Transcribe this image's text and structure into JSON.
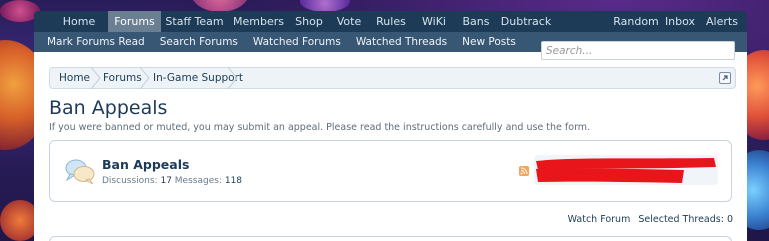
{
  "nav": {
    "tabs": [
      {
        "label": "Home",
        "active": false
      },
      {
        "label": "Forums",
        "active": true
      },
      {
        "label": "Staff Team",
        "active": false
      },
      {
        "label": "Members",
        "active": false
      },
      {
        "label": "Shop",
        "active": false
      },
      {
        "label": "Vote",
        "active": false
      },
      {
        "label": "Rules",
        "active": false
      },
      {
        "label": "WiKi",
        "active": false
      },
      {
        "label": "Bans",
        "active": false
      },
      {
        "label": "Dubtrack",
        "active": false
      }
    ],
    "right": [
      "Random",
      "Inbox",
      "Alerts"
    ]
  },
  "subnav": [
    "Mark Forums Read",
    "Search Forums",
    "Watched Forums",
    "Watched Threads",
    "New Posts"
  ],
  "search": {
    "placeholder": "Search..."
  },
  "breadcrumb": [
    "Home",
    "Forums",
    "In-Game Support"
  ],
  "page": {
    "title": "Ban Appeals",
    "description": "If you were banned or muted, you may submit an appeal. Please read the instructions carefully and use the form."
  },
  "forum": {
    "title": "Ban Appeals",
    "discussions_label": "Discussions:",
    "discussions": "17",
    "messages_label": "Messages:",
    "messages": "118",
    "icon": "speech-bubbles-icon",
    "rss_icon": "rss-icon"
  },
  "footer": {
    "watch": "Watch Forum",
    "selected": "Selected Threads: 0"
  },
  "colors": {
    "nav_bg": "#1d3b57",
    "subnav_bg": "#385774",
    "accent": "#1d3b57",
    "redaction": "#e8161a"
  }
}
